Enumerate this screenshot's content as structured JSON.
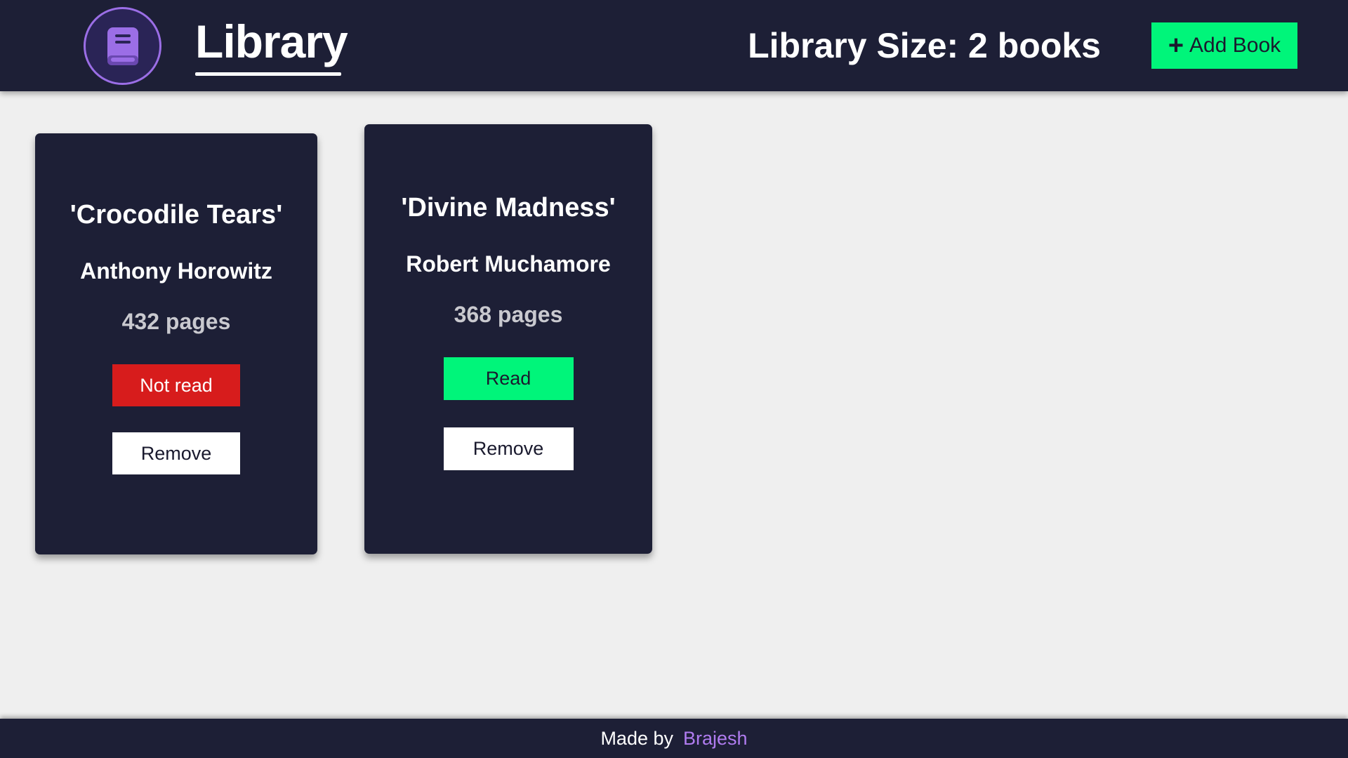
{
  "header": {
    "logo_icon": "book-icon",
    "title": "Library",
    "library_size": "Library Size: 2 books",
    "add_book_label": "Add Book",
    "add_icon": "plus-icon"
  },
  "books": [
    {
      "title": "'Crocodile Tears'",
      "author": "Anthony Horowitz",
      "pages": "432 pages",
      "status": "Not read",
      "remove_label": "Remove"
    },
    {
      "title": "'Divine Madness'",
      "author": "Robert Muchamore",
      "pages": "368 pages",
      "status": "Read",
      "remove_label": "Remove"
    }
  ],
  "footer": {
    "made_by": "Made by",
    "author": "Brajesh"
  },
  "colors": {
    "navy": "#1d1f36",
    "accent_purple": "#9b6ee6",
    "read_green": "#00f57a",
    "not_read_red": "#d71c1c",
    "background": "#efefef"
  }
}
